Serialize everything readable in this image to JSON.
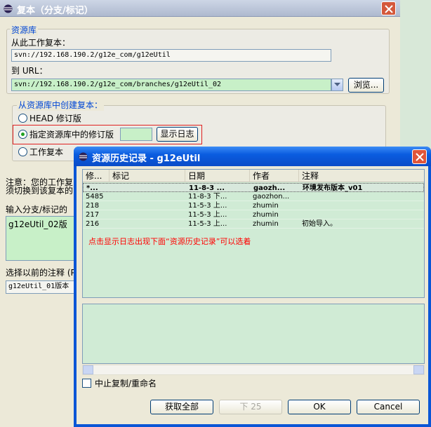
{
  "window_main": {
    "title": "复本（分支/标记）",
    "repo_group": "资源库",
    "from_label": "从此工作复本：",
    "from_value": "svn://192.168.190.2/g12e_com/g12eUtil",
    "to_label": "到 URL：",
    "to_value": "svn://192.168.190.2/g12e_com/branches/g12eUtil_02",
    "browse_button": "浏览...",
    "create_group": "从资源库中创建复本：",
    "radio_head": "HEAD 修订版",
    "radio_specific": "指定资源库中的修订版",
    "revision_value": "",
    "show_log_button": "显示日志",
    "radio_working": "工作复本",
    "note_line1": "注意：您的工作复",
    "note_line2": "须切换到该复本的",
    "enter_label": "输入分支/标记的",
    "enter_value": "g12eUtil_02版",
    "prev_label": "选择以前的注释 (P",
    "prev_value": "g12eUtil_01版本"
  },
  "dialog": {
    "title": "资源历史记录 - g12eUtil",
    "columns": [
      "修...",
      "标记",
      "日期",
      "作者",
      "注释"
    ],
    "rows": [
      {
        "rev": "*...",
        "tag": "",
        "date": "11-8-3 ...",
        "author": "gaozh...",
        "comment": "环境发布版本_v01",
        "bold": true,
        "selected": true
      },
      {
        "rev": "5485",
        "tag": "",
        "date": "11-8-3 下...",
        "author": "gaozhon...",
        "comment": "",
        "bold": false,
        "selected": false
      },
      {
        "rev": "218",
        "tag": "",
        "date": "11-5-3 上...",
        "author": "zhumin",
        "comment": "",
        "bold": false,
        "selected": false
      },
      {
        "rev": "217",
        "tag": "",
        "date": "11-5-3 上...",
        "author": "zhumin",
        "comment": "",
        "bold": false,
        "selected": false
      },
      {
        "rev": "216",
        "tag": "",
        "date": "11-5-3 上...",
        "author": "zhumin",
        "comment": "初始导入。",
        "bold": false,
        "selected": false
      }
    ],
    "annotation": "点击显示日志出现下面“资源历史记录”可以选着",
    "stop_copy_label": "中止复制/重命名",
    "btn_get_all": "获取全部",
    "btn_next": "下 25",
    "btn_ok": "OK",
    "btn_cancel": "Cancel"
  },
  "colors": {
    "highlight_box": "#e02020",
    "annotation_text": "#ff0000",
    "table_bg": "#d0ebd5",
    "dialog_title_bar": "#0a5ce0"
  },
  "icons": [
    "eclipse-icon",
    "close-icon",
    "dropdown-arrow-icon"
  ]
}
